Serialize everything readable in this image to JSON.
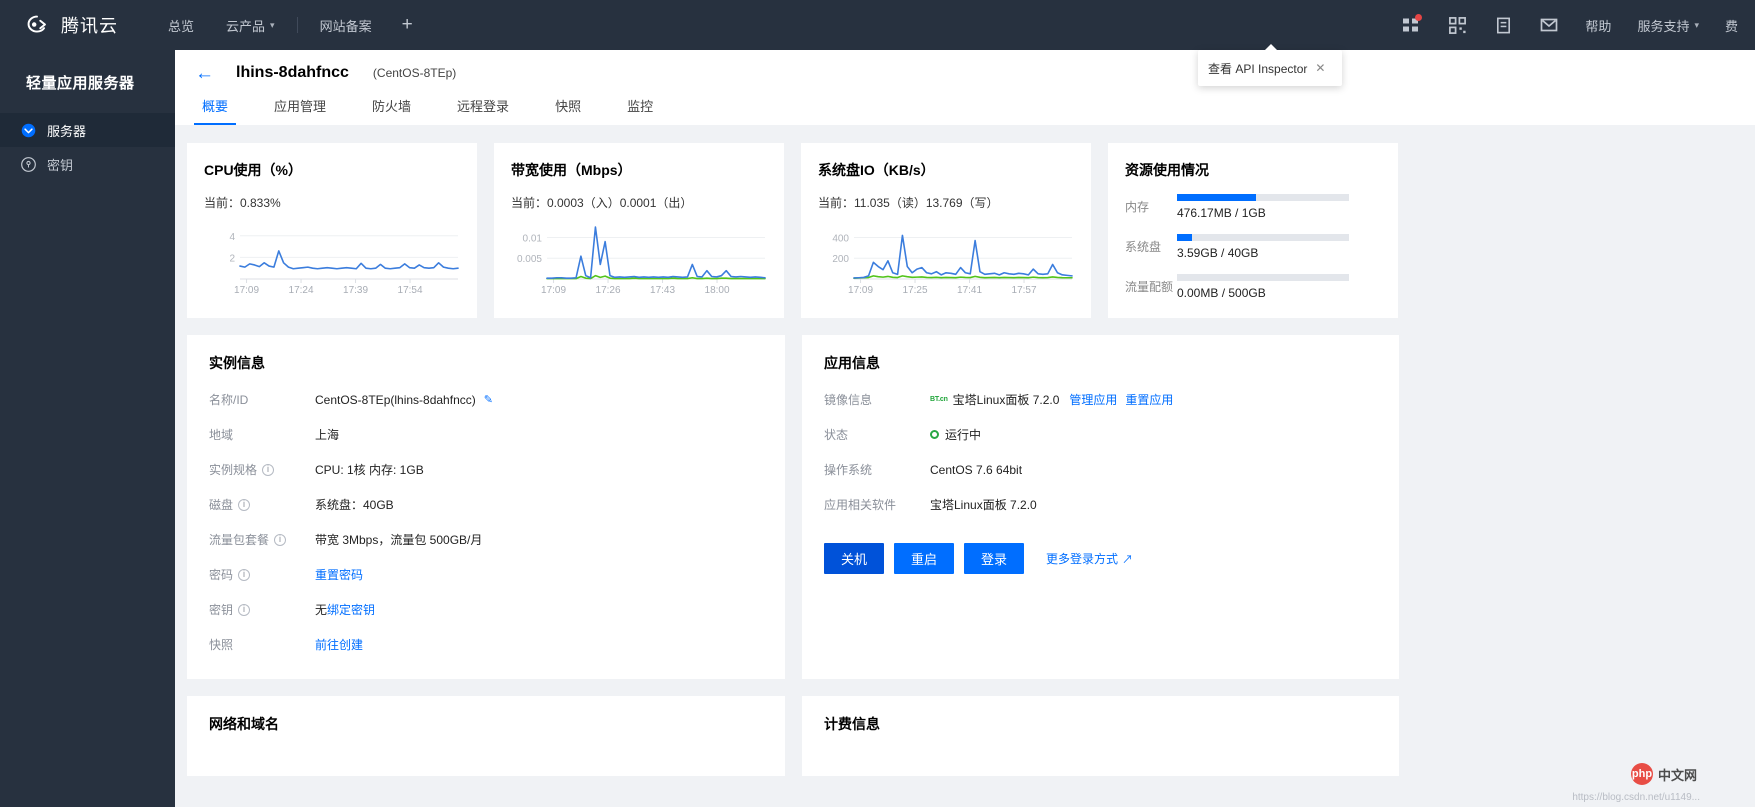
{
  "header": {
    "brand": "腾讯云",
    "nav": [
      {
        "label": "总览",
        "caret": false
      },
      {
        "label": "云产品",
        "caret": true
      },
      {
        "label": "网站备案",
        "caret": false
      }
    ],
    "add_label": "+",
    "icons": [
      {
        "name": "apps-icon",
        "badge": true
      },
      {
        "name": "qrcode-icon",
        "badge": false
      },
      {
        "name": "document-icon",
        "badge": false
      },
      {
        "name": "mail-icon",
        "badge": false
      }
    ],
    "right_links": [
      {
        "label": "帮助",
        "caret": false
      },
      {
        "label": "服务支持",
        "caret": true
      },
      {
        "label": "费",
        "caret": false
      }
    ],
    "api_tooltip": {
      "text": "查看 API Inspector",
      "close": "✕"
    }
  },
  "sidebar": {
    "title": "轻量应用服务器",
    "items": [
      {
        "label": "服务器",
        "icon": "server-icon",
        "active": true
      },
      {
        "label": "密钥",
        "icon": "key-icon",
        "active": false
      }
    ]
  },
  "page": {
    "back_icon": "←",
    "title": "lhins-8dahfncc",
    "subtitle": "(CentOS-8TEp)",
    "tabs": [
      {
        "label": "概要",
        "active": true
      },
      {
        "label": "应用管理",
        "active": false
      },
      {
        "label": "防火墙",
        "active": false
      },
      {
        "label": "远程登录",
        "active": false
      },
      {
        "label": "快照",
        "active": false
      },
      {
        "label": "监控",
        "active": false
      }
    ]
  },
  "chart_data": [
    {
      "type": "line",
      "title": "CPU使用（%）",
      "subtitle": "当前：0.833%",
      "xlabel": "",
      "ylabel": "",
      "yticks": [
        2,
        4
      ],
      "ylim": [
        0,
        5
      ],
      "xticks": [
        "17:09",
        "17:24",
        "17:39",
        "17:54"
      ],
      "series": [
        {
          "name": "CPU",
          "color": "#3b7ddd",
          "values": [
            1.2,
            1.1,
            1.4,
            1.3,
            1.15,
            1.5,
            1.2,
            1.1,
            2.6,
            1.5,
            1.1,
            0.95,
            1.0,
            1.05,
            1.1,
            1.0,
            0.95,
            1.0,
            1.05,
            1.0,
            0.95,
            1.0,
            1.05,
            1.0,
            0.95,
            1.45,
            1.0,
            0.95,
            1.0,
            1.35,
            1.0,
            0.95,
            1.0,
            1.05,
            1.4,
            1.05,
            1.0,
            1.3,
            1.05,
            1.0,
            1.05,
            1.5,
            1.1,
            1.0,
            0.95,
            1.0
          ]
        }
      ]
    },
    {
      "type": "line",
      "title": "带宽使用（Mbps）",
      "subtitle": "当前：0.0003（入）0.0001（出）",
      "yticks": [
        0.005,
        0.01
      ],
      "ylim": [
        0,
        0.013
      ],
      "xticks": [
        "17:09",
        "17:26",
        "17:43",
        "18:00"
      ],
      "series": [
        {
          "name": "入",
          "color": "#3b7ddd",
          "values": [
            0.0002,
            0.0002,
            0.0003,
            0.0003,
            0.0002,
            0.0002,
            0.0003,
            0.0055,
            0.0008,
            0.0003,
            0.0125,
            0.0035,
            0.009,
            0.0008,
            0.0004,
            0.0005,
            0.0004,
            0.0005,
            0.0006,
            0.0004,
            0.0005,
            0.0004,
            0.0005,
            0.0004,
            0.0005,
            0.0004,
            0.0006,
            0.0005,
            0.0004,
            0.0005,
            0.0035,
            0.0006,
            0.0005,
            0.002,
            0.0006,
            0.0005,
            0.0008,
            0.002,
            0.0006,
            0.0005,
            0.0006,
            0.0005,
            0.0004,
            0.0005,
            0.0004,
            0.0003
          ]
        },
        {
          "name": "出",
          "color": "#52c41a",
          "values": [
            0.0001,
            0.0001,
            0.0001,
            0.0001,
            0.0001,
            0.0001,
            0.0001,
            0.0006,
            0.0002,
            0.0001,
            0.0008,
            0.0004,
            0.0007,
            0.0002,
            0.0001,
            0.0001,
            0.0001,
            0.0001,
            0.0002,
            0.0001,
            0.0001,
            0.0001,
            0.0001,
            0.0001,
            0.0001,
            0.0001,
            0.0002,
            0.0001,
            0.0001,
            0.0001,
            0.0003,
            0.0001,
            0.0001,
            0.0002,
            0.0001,
            0.0001,
            0.0002,
            0.0002,
            0.0001,
            0.0001,
            0.0001,
            0.0001,
            0.0001,
            0.0001,
            0.0001,
            0.0001
          ]
        }
      ]
    },
    {
      "type": "line",
      "title": "系统盘IO（KB/s）",
      "subtitle": "当前：11.035（读）13.769（写）",
      "yticks": [
        200,
        400
      ],
      "ylim": [
        0,
        520
      ],
      "xticks": [
        "17:09",
        "17:25",
        "17:41",
        "17:57"
      ],
      "series": [
        {
          "name": "读",
          "color": "#3b7ddd",
          "values": [
            10,
            12,
            15,
            30,
            160,
            120,
            90,
            175,
            60,
            45,
            420,
            120,
            60,
            95,
            110,
            60,
            50,
            70,
            40,
            60,
            55,
            45,
            110,
            60,
            50,
            370,
            70,
            45,
            50,
            55,
            40,
            60,
            50,
            45,
            55,
            50,
            40,
            95,
            50,
            45,
            50,
            140,
            60,
            40,
            35,
            30
          ]
        },
        {
          "name": "写",
          "color": "#52c41a",
          "values": [
            8,
            10,
            12,
            14,
            30,
            22,
            18,
            25,
            16,
            14,
            30,
            22,
            16,
            18,
            20,
            15,
            14,
            16,
            13,
            15,
            14,
            13,
            18,
            15,
            14,
            25,
            16,
            13,
            14,
            15,
            13,
            15,
            14,
            13,
            15,
            14,
            13,
            18,
            14,
            13,
            14,
            20,
            15,
            13,
            12,
            12
          ]
        }
      ]
    }
  ],
  "usage_card": {
    "title": "资源使用情况",
    "rows": [
      {
        "label": "内存",
        "value": "476.17MB / 1GB",
        "percent": 46
      },
      {
        "label": "系统盘",
        "value": "3.59GB / 40GB",
        "percent": 9
      },
      {
        "label": "流量配额",
        "value": "0.00MB / 500GB",
        "percent": 0
      }
    ]
  },
  "instance_info": {
    "title": "实例信息",
    "rows": [
      {
        "label": "名称/ID",
        "has_info": false,
        "value": "CentOS-8TEp(lhins-8dahfncc)",
        "edit": true
      },
      {
        "label": "地域",
        "has_info": false,
        "value": "上海"
      },
      {
        "label": "实例规格",
        "has_info": true,
        "value": "CPU: 1核 内存: 1GB"
      },
      {
        "label": "磁盘",
        "has_info": true,
        "value": "系统盘：40GB"
      },
      {
        "label": "流量包套餐",
        "has_info": true,
        "value": "带宽 3Mbps，流量包 500GB/月"
      },
      {
        "label": "密码",
        "has_info": true,
        "value": "",
        "link": "重置密码"
      },
      {
        "label": "密钥",
        "has_info": true,
        "value": "无",
        "link": "绑定密钥"
      },
      {
        "label": "快照",
        "has_info": false,
        "value": "",
        "link": "前往创建"
      }
    ]
  },
  "app_info": {
    "title": "应用信息",
    "image_label": "镜像信息",
    "image_badge": "BT.cn",
    "image_value": "宝塔Linux面板 7.2.0",
    "image_links": [
      "管理应用",
      "重置应用"
    ],
    "status_label": "状态",
    "status_value": "运行中",
    "os_label": "操作系统",
    "os_value": "CentOS 7.6 64bit",
    "software_label": "应用相关软件",
    "software_value": "宝塔Linux面板 7.2.0",
    "buttons": [
      {
        "label": "关机",
        "style": "dark"
      },
      {
        "label": "重启",
        "style": "primary"
      },
      {
        "label": "登录",
        "style": "primary"
      }
    ],
    "more_login": "更多登录方式",
    "more_login_icon": "↗"
  },
  "bottom_cards": {
    "network_title": "网络和域名",
    "billing_title": "计费信息"
  },
  "watermark": {
    "badge": "php",
    "text": "中文网",
    "url": "https://blog.csdn.net/u1149..."
  },
  "colors": {
    "accent": "#006eff",
    "header_bg": "#27313f",
    "chart_blue": "#3b7ddd",
    "chart_green": "#52c41a",
    "status_green": "#29a745"
  }
}
